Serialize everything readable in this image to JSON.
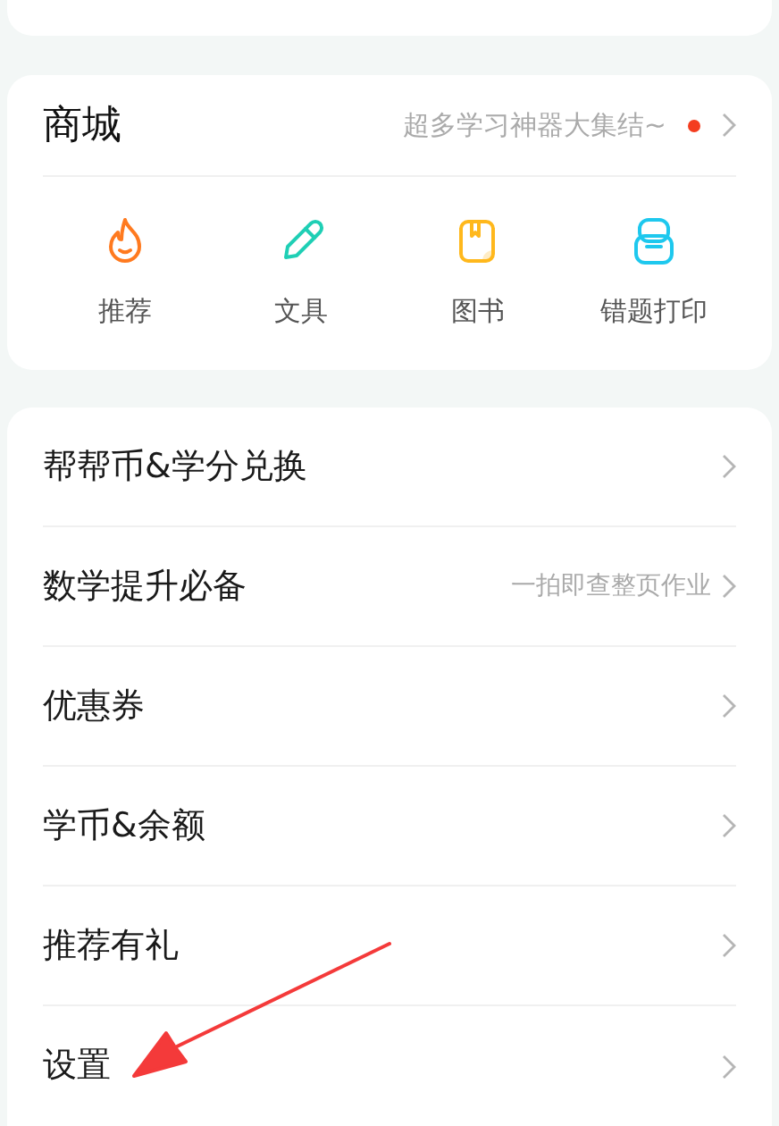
{
  "mall": {
    "title": "商城",
    "subtitle": "超多学习神器大集结~",
    "has_new": true,
    "items": [
      {
        "kind": "flame",
        "label": "推荐",
        "color": "#ff7a1f"
      },
      {
        "kind": "pencil",
        "label": "文具",
        "color": "#1fcfb5"
      },
      {
        "kind": "book",
        "label": "图书",
        "color": "#ffb81c"
      },
      {
        "kind": "printer",
        "label": "错题打印",
        "color": "#1ec8ee"
      }
    ]
  },
  "menu": [
    {
      "label": "帮帮币&学分兑换"
    },
    {
      "label": "数学提升必备",
      "hint": "一拍即查整页作业"
    },
    {
      "label": "优惠券"
    },
    {
      "label": "学币&余额"
    },
    {
      "label": "推荐有礼"
    },
    {
      "label": "设置"
    }
  ]
}
